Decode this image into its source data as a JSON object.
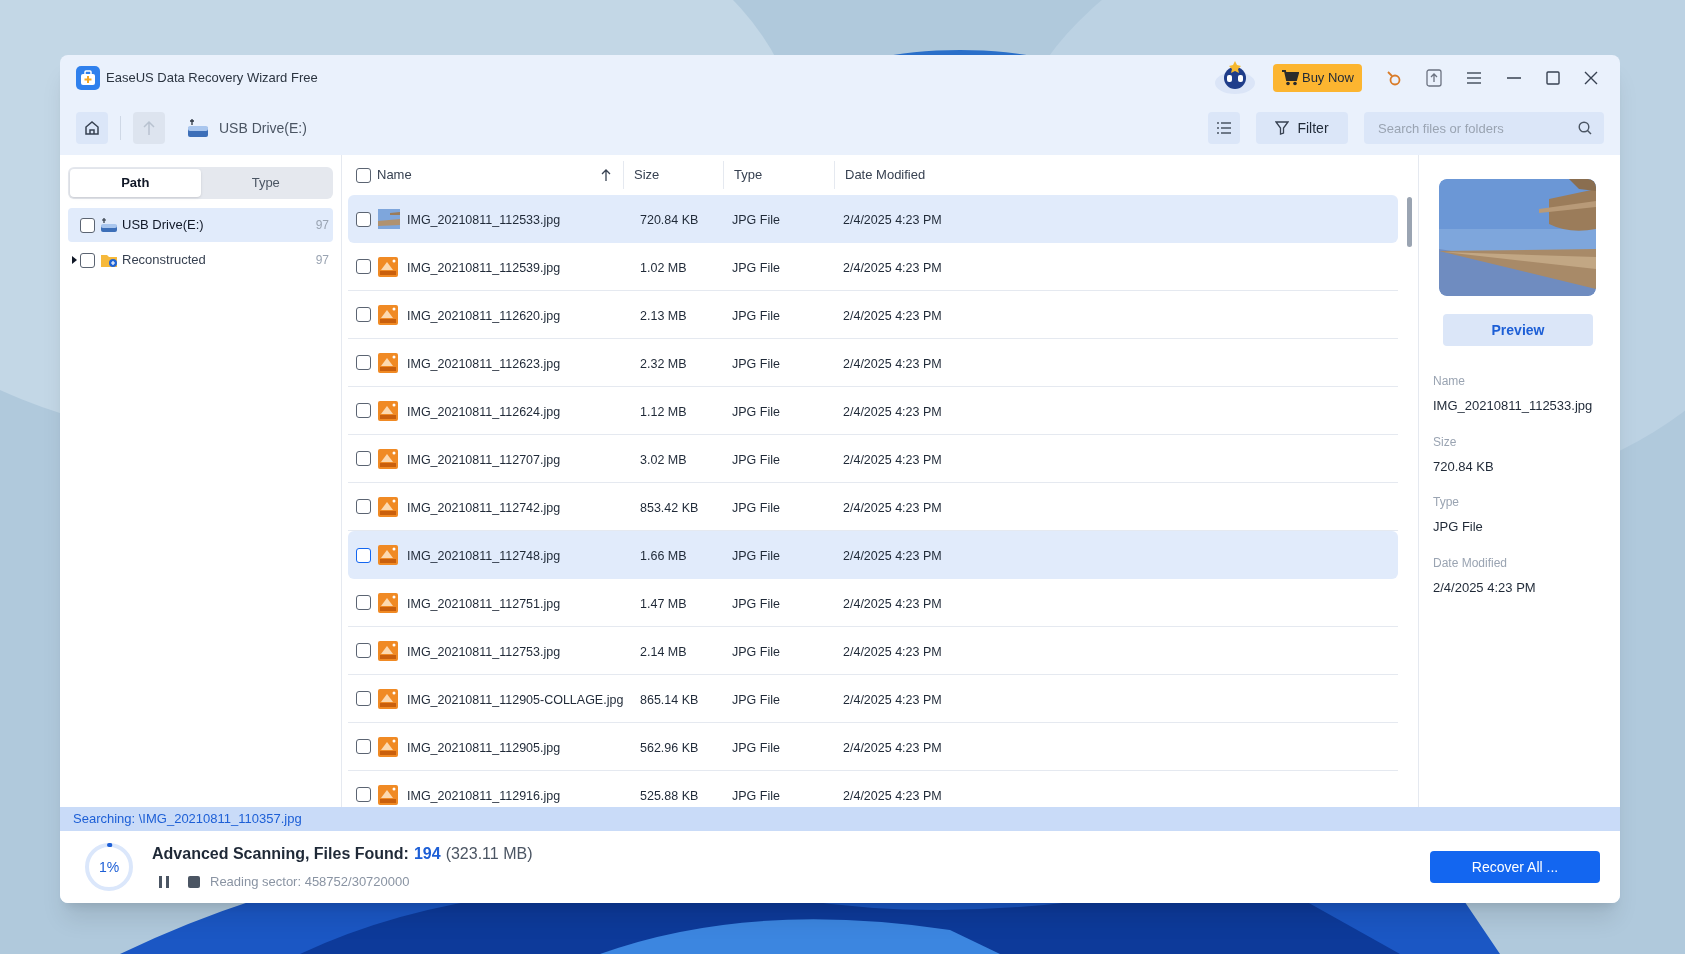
{
  "window": {
    "title": "EaseUS Data Recovery Wizard Free"
  },
  "title_bar": {
    "buy_button": "Buy Now"
  },
  "toolbar": {
    "location": "USB Drive(E:)",
    "filter_button": "Filter",
    "search": {
      "placeholder": "Search files or folders"
    }
  },
  "sidebar": {
    "tabs": [
      {
        "label": "Path",
        "selected": true
      },
      {
        "label": "Type",
        "selected": false
      }
    ],
    "tree": [
      {
        "kind": "drive",
        "label": "USB Drive(E:)",
        "count": "97",
        "selected": true,
        "checked": false
      },
      {
        "kind": "folder",
        "label": "Reconstructed",
        "count": "97",
        "selected": false,
        "checked": false,
        "expanded": false
      }
    ]
  },
  "table": {
    "all_checked": false,
    "columns": [
      {
        "label": "Name",
        "sorted": true
      },
      {
        "label": "Size",
        "sorted": false
      },
      {
        "label": "Type",
        "sorted": false
      },
      {
        "label": "Date Modified",
        "sorted": false
      }
    ],
    "rows": [
      {
        "kind": "thumbnail",
        "name": "IMG_20210811_112533.jpg",
        "size": "720.84 KB",
        "type": "JPG File",
        "date": "2/4/2025 4:23 PM",
        "selected": true,
        "checked": false
      },
      {
        "kind": "jpg",
        "name": "IMG_20210811_112539.jpg",
        "size": "1.02 MB",
        "type": "JPG File",
        "date": "2/4/2025 4:23 PM",
        "selected": false,
        "checked": false
      },
      {
        "kind": "jpg",
        "name": "IMG_20210811_112620.jpg",
        "size": "2.13 MB",
        "type": "JPG File",
        "date": "2/4/2025 4:23 PM",
        "selected": false,
        "checked": false
      },
      {
        "kind": "jpg",
        "name": "IMG_20210811_112623.jpg",
        "size": "2.32 MB",
        "type": "JPG File",
        "date": "2/4/2025 4:23 PM",
        "selected": false,
        "checked": false
      },
      {
        "kind": "jpg",
        "name": "IMG_20210811_112624.jpg",
        "size": "1.12 MB",
        "type": "JPG File",
        "date": "2/4/2025 4:23 PM",
        "selected": false,
        "checked": false
      },
      {
        "kind": "jpg",
        "name": "IMG_20210811_112707.jpg",
        "size": "3.02 MB",
        "type": "JPG File",
        "date": "2/4/2025 4:23 PM",
        "selected": false,
        "checked": false
      },
      {
        "kind": "jpg",
        "name": "IMG_20210811_112742.jpg",
        "size": "853.42 KB",
        "type": "JPG File",
        "date": "2/4/2025 4:23 PM",
        "selected": false,
        "checked": false
      },
      {
        "kind": "jpg",
        "name": "IMG_20210811_112748.jpg",
        "size": "1.66 MB",
        "type": "JPG File",
        "date": "2/4/2025 4:23 PM",
        "selected": true,
        "checked": false
      },
      {
        "kind": "jpg",
        "name": "IMG_20210811_112751.jpg",
        "size": "1.47 MB",
        "type": "JPG File",
        "date": "2/4/2025 4:23 PM",
        "selected": false,
        "checked": false
      },
      {
        "kind": "jpg",
        "name": "IMG_20210811_112753.jpg",
        "size": "2.14 MB",
        "type": "JPG File",
        "date": "2/4/2025 4:23 PM",
        "selected": false,
        "checked": false
      },
      {
        "kind": "jpg",
        "name": "IMG_20210811_112905-COLLAGE.jpg",
        "size": "865.14 KB",
        "type": "JPG File",
        "date": "2/4/2025 4:23 PM",
        "selected": false,
        "checked": false
      },
      {
        "kind": "jpg",
        "name": "IMG_20210811_112905.jpg",
        "size": "562.96 KB",
        "type": "JPG File",
        "date": "2/4/2025 4:23 PM",
        "selected": false,
        "checked": false
      },
      {
        "kind": "jpg",
        "name": "IMG_20210811_112916.jpg",
        "size": "525.88 KB",
        "type": "JPG File",
        "date": "2/4/2025 4:23 PM",
        "selected": false,
        "checked": false
      }
    ]
  },
  "details": {
    "preview_button": "Preview",
    "fields": [
      {
        "label": "Name",
        "value": "IMG_20210811_112533.jpg"
      },
      {
        "label": "Size",
        "value": "720.84 KB"
      },
      {
        "label": "Type",
        "value": "JPG File"
      },
      {
        "label": "Date Modified",
        "value": "2/4/2025 4:23 PM"
      }
    ]
  },
  "status_bar": {
    "searching": "Searching: \\IMG_20210811_110357.jpg"
  },
  "scan": {
    "percent": "1%",
    "level": 0.01,
    "label": "Advanced Scanning, Files Found:",
    "found_count": "194",
    "found_size": "(323.11 MB)",
    "sector": "Reading sector: 458752/30720000",
    "recover_button": "Recover All ..."
  }
}
